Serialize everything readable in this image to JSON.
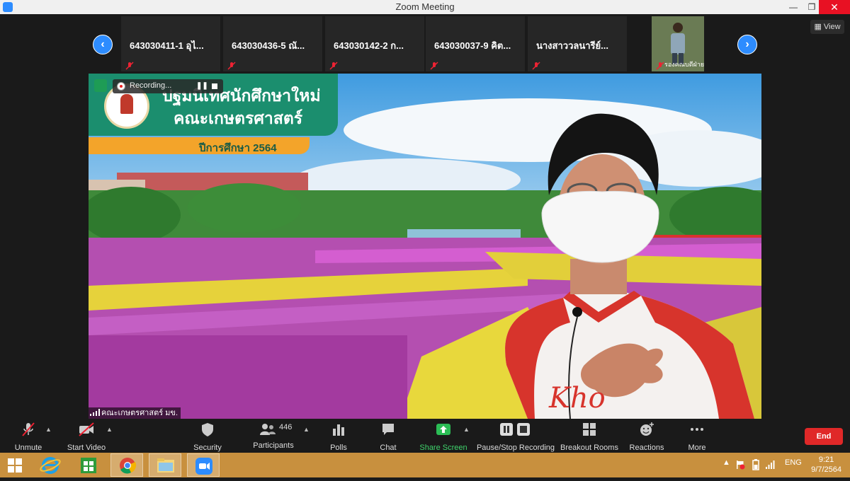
{
  "window": {
    "title": "Zoom Meeting",
    "minimize_icon": "minimize-icon",
    "restore_icon": "restore-icon",
    "close_icon": "close-icon",
    "close_color": "#e81123"
  },
  "gallery": {
    "prev_icon": "chevron-left-icon",
    "next_icon": "chevron-right-icon",
    "view_label": "View",
    "participants": [
      {
        "name": "643030411-1 อุไ...",
        "mic": "muted"
      },
      {
        "name": "643030436-5 ณั...",
        "mic": "muted"
      },
      {
        "name": "643030142-2 ก...",
        "mic": "muted"
      },
      {
        "name": "643030037-9 คิต...",
        "mic": "muted"
      },
      {
        "name": "นางสาววลนารีย์...",
        "mic": "muted"
      },
      {
        "name": "รองคณบดีฝ่ายวิชาการ...",
        "mic": "muted"
      }
    ]
  },
  "stage": {
    "banner_line1": "ปฐมนิเทศนักศึกษาใหม่",
    "banner_line2": "คณะเกษตรศาสตร์",
    "banner_year": "ปีการศึกษา 2564",
    "recording_label": "Recording...",
    "speaker_name": "คณะเกษตรศาสตร์ มข.",
    "banner_color": "#1b8e6e",
    "year_color": "#f3a42a"
  },
  "toolbar": {
    "unmute": "Unmute",
    "start_video": "Start Video",
    "security": "Security",
    "participants_label": "Participants",
    "participants_count": "446",
    "polls": "Polls",
    "chat": "Chat",
    "share_screen": "Share Screen",
    "pause_stop_recording": "Pause/Stop Recording",
    "breakout_rooms": "Breakout Rooms",
    "reactions": "Reactions",
    "more": "More",
    "end": "End",
    "end_color": "#e02828",
    "share_color": "#3fd26b"
  },
  "taskbar": {
    "language": "ENG",
    "time": "9:21",
    "date": "9/7/2564",
    "color": "#c8903e"
  }
}
